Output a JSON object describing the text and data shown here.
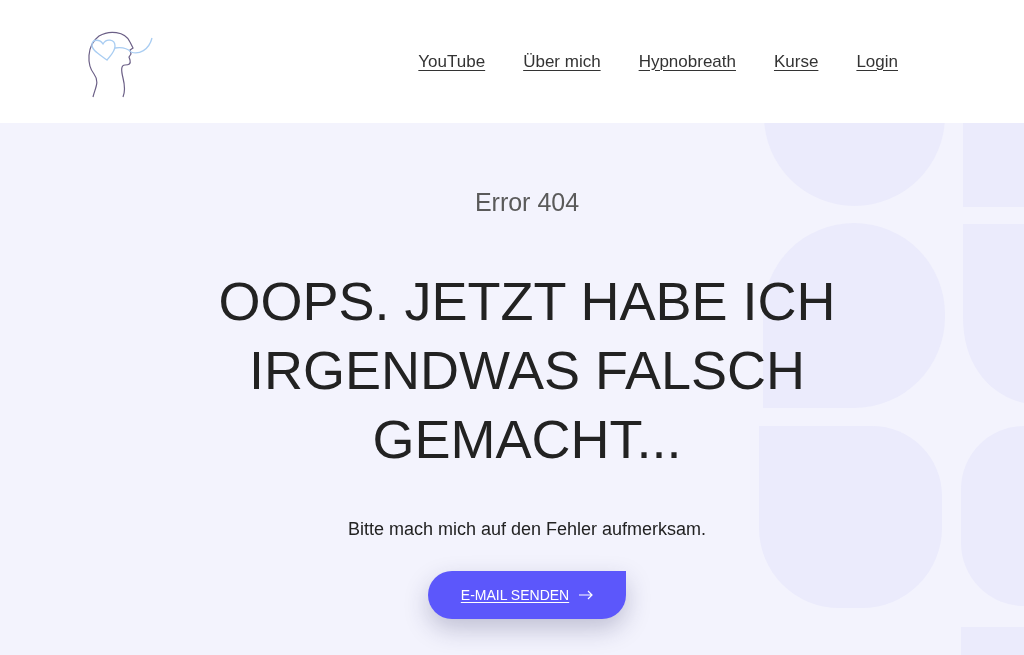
{
  "header": {
    "nav": [
      "YouTube",
      "Über mich",
      "Hypnobreath",
      "Kurse",
      "Login"
    ]
  },
  "error": {
    "code": "Error 404",
    "headline": "OOPS. JETZT HABE ICH IRGENDWAS FALSCH GEMACHT...",
    "message": "Bitte mach mich auf den Fehler aufmerksam.",
    "button": "E-MAIL SENDEN"
  }
}
